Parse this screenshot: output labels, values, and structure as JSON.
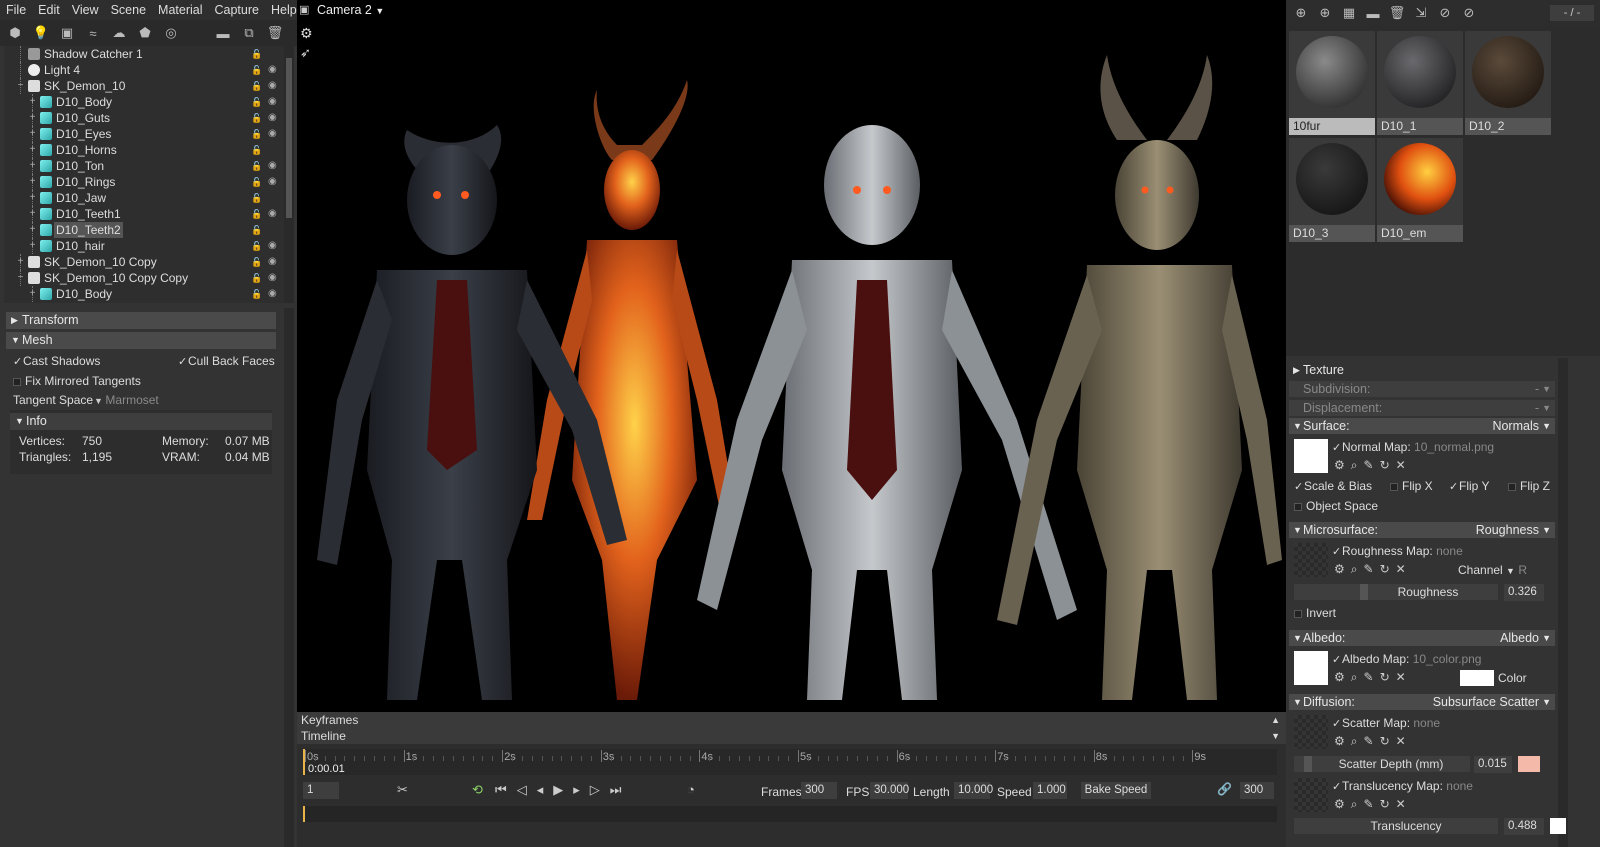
{
  "menu": [
    "File",
    "Edit",
    "View",
    "Scene",
    "Material",
    "Capture",
    "Help"
  ],
  "toolbar_icons": [
    "cube-icon",
    "bulb-icon",
    "camera-icon",
    "wave-icon",
    "cloud-icon",
    "box-icon",
    "target-icon",
    "folder-icon",
    "new-icon",
    "trash-icon"
  ],
  "tree": [
    {
      "label": "Shadow Catcher 1",
      "indent": 1,
      "icon": "shadow",
      "expand": false,
      "eye": false
    },
    {
      "label": "Light 4",
      "indent": 1,
      "icon": "bulb",
      "expand": false,
      "eye": true
    },
    {
      "label": "SK_Demon_10",
      "indent": 1,
      "icon": "skin",
      "expand": "minus",
      "eye": true
    },
    {
      "label": "D10_Body",
      "indent": 2,
      "icon": "cube",
      "expand": "plus",
      "eye": true
    },
    {
      "label": "D10_Guts",
      "indent": 2,
      "icon": "cube",
      "expand": "plus",
      "eye": true
    },
    {
      "label": "D10_Eyes",
      "indent": 2,
      "icon": "cube",
      "expand": "plus",
      "eye": true
    },
    {
      "label": "D10_Horns",
      "indent": 2,
      "icon": "cube",
      "expand": "plus",
      "eye": false
    },
    {
      "label": "D10_Ton",
      "indent": 2,
      "icon": "cube",
      "expand": "plus",
      "eye": true
    },
    {
      "label": "D10_Rings",
      "indent": 2,
      "icon": "cube",
      "expand": "plus",
      "eye": true
    },
    {
      "label": "D10_Jaw",
      "indent": 2,
      "icon": "cube",
      "expand": "plus",
      "eye": false
    },
    {
      "label": "D10_Teeth1",
      "indent": 2,
      "icon": "cube",
      "expand": "plus",
      "eye": true
    },
    {
      "label": "D10_Teeth2",
      "indent": 2,
      "icon": "cube",
      "expand": "plus",
      "eye": false,
      "selected": true
    },
    {
      "label": "D10_hair",
      "indent": 2,
      "icon": "cube",
      "expand": "plus",
      "eye": true
    },
    {
      "label": "SK_Demon_10 Copy",
      "indent": 1,
      "icon": "skin",
      "expand": "plus",
      "eye": true
    },
    {
      "label": "SK_Demon_10 Copy Copy",
      "indent": 1,
      "icon": "skin",
      "expand": "minus",
      "eye": true
    },
    {
      "label": "D10_Body",
      "indent": 2,
      "icon": "cube",
      "expand": "plus",
      "eye": true
    }
  ],
  "props": {
    "transform": "Transform",
    "mesh": "Mesh",
    "cast_shadows": "Cast Shadows",
    "cull_back_faces": "Cull Back Faces",
    "fix_mirrored": "Fix Mirrored Tangents",
    "tangent_space_label": "Tangent Space",
    "tangent_space_value": "Marmoset",
    "info": "Info",
    "vertices_label": "Vertices:",
    "vertices": "750",
    "triangles_label": "Triangles:",
    "triangles": "1,195",
    "memory_label": "Memory:",
    "memory": "0.07 MB",
    "vram_label": "VRAM:",
    "vram": "0.04 MB"
  },
  "viewport": {
    "camera": "Camera 2"
  },
  "timeline": {
    "keyframes": "Keyframes",
    "timeline": "Timeline",
    "ticks": [
      "0s",
      "1s",
      "2s",
      "3s",
      "4s",
      "5s",
      "6s",
      "7s",
      "8s",
      "9s"
    ],
    "current_time": "0:00.01",
    "frame": "1",
    "frames_label": "Frames",
    "frames": "300",
    "fps_label": "FPS",
    "fps": "30.000",
    "length_label": "Length",
    "length": "10.000",
    "speed_label": "Speed",
    "speed": "1.000",
    "bake_speed": "Bake Speed",
    "end_frame": "300"
  },
  "right": {
    "counter": "- / -",
    "materials": [
      {
        "label": "10fur",
        "selected": true,
        "color": "gray"
      },
      {
        "label": "D10_1",
        "color": "dark"
      },
      {
        "label": "D10_2",
        "color": "brown"
      },
      {
        "label": "D10_3",
        "color": "black"
      },
      {
        "label": "D10_em",
        "color": "lava"
      }
    ],
    "texture": "Texture",
    "subdivision": "Subdivision:",
    "displacement": "Displacement:",
    "dash": "-",
    "surface": "Surface:",
    "surface_value": "Normals",
    "normal_map_label": "Normal Map:",
    "normal_map": "10_normal.png",
    "scale_bias": "Scale & Bias",
    "flip_x": "Flip X",
    "flip_y": "Flip Y",
    "flip_z": "Flip Z",
    "object_space": "Object Space",
    "microsurface": "Microsurface:",
    "microsurface_value": "Roughness",
    "roughness_map_label": "Roughness Map:",
    "roughness_map": "none",
    "channel_label": "Channel",
    "channel": "R",
    "roughness_label": "Roughness",
    "roughness": "0.326",
    "invert": "Invert",
    "albedo": "Albedo:",
    "albedo_value": "Albedo",
    "albedo_map_label": "Albedo Map:",
    "albedo_map": "10_color.png",
    "color_label": "Color",
    "diffusion": "Diffusion:",
    "diffusion_value": "Subsurface Scatter",
    "scatter_map_label": "Scatter Map:",
    "scatter_map": "none",
    "scatter_depth_label": "Scatter Depth (mm)",
    "scatter_depth": "0.015",
    "translucency_map_label": "Translucency Map:",
    "translucency_map": "none",
    "translucency_label": "Translucency",
    "translucency": "0.488",
    "colors": {
      "scatter": "#f4b9a8",
      "albedo": "#ffffff"
    }
  }
}
